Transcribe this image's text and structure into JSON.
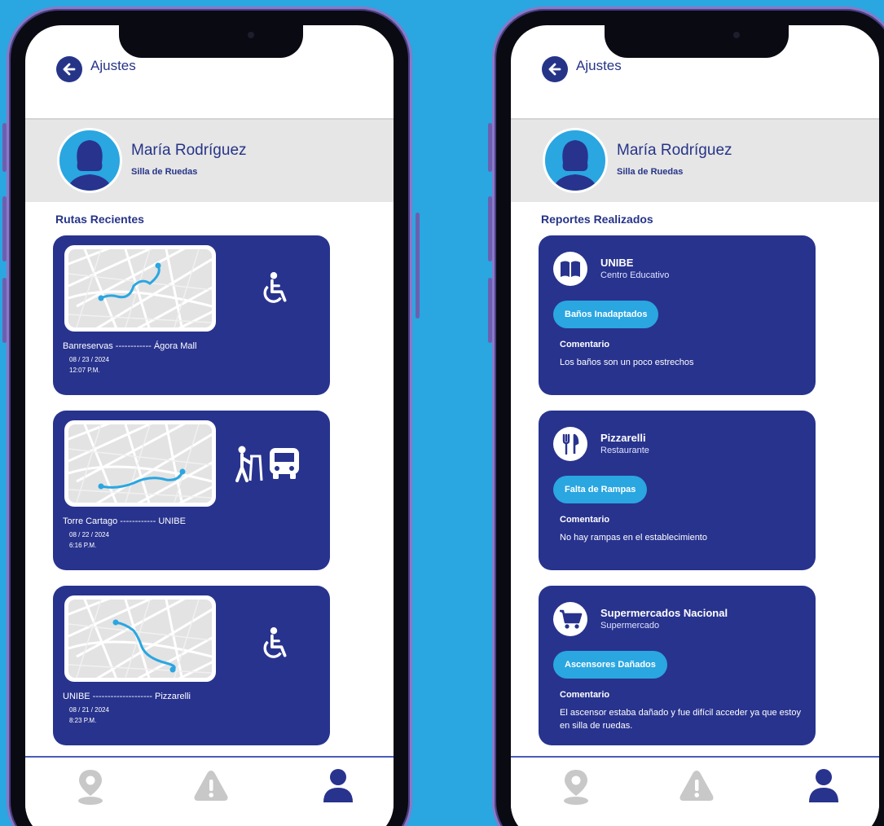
{
  "colors": {
    "background": "#2aa6e1",
    "primary": "#28338e",
    "accent": "#2aa6e1",
    "nav_inactive": "#c8c8c8"
  },
  "left_screen": {
    "header": {
      "title": "Ajustes",
      "back_icon": "arrow-left-icon"
    },
    "profile": {
      "name": "María Rodríguez",
      "subtitle": "Silla de Ruedas",
      "avatar_icon": "user-avatar-icon"
    },
    "section_title": "Rutas Recientes",
    "routes": [
      {
        "route": "Banreservas ------------ Ágora Mall",
        "date": "08 / 23 / 2024",
        "time": "12:07 P.M.",
        "mode_icon": "wheelchair-icon"
      },
      {
        "route": "Torre Cartago ------------ UNIBE",
        "date": "08 / 22 / 2024",
        "time": "6:16 P.M.",
        "mode_icons": [
          "walker-icon",
          "bus-icon"
        ]
      },
      {
        "route": "UNIBE -------------------- Pizzarelli",
        "date": "08 / 21 / 2024",
        "time": "8:23 P.M.",
        "mode_icon": "wheelchair-icon"
      }
    ]
  },
  "right_screen": {
    "header": {
      "title": "Ajustes",
      "back_icon": "arrow-left-icon"
    },
    "profile": {
      "name": "María Rodríguez",
      "subtitle": "Silla de Ruedas",
      "avatar_icon": "user-avatar-icon"
    },
    "section_title": "Reportes Realizados",
    "reports": [
      {
        "place": "UNIBE",
        "type": "Centro Educativo",
        "icon": "book-icon",
        "tag": "Baños Inadaptados",
        "comment_label": "Comentario",
        "comment": "Los baños son un poco estrechos"
      },
      {
        "place": "Pizzarelli",
        "type": "Restaurante",
        "icon": "fork-knife-icon",
        "tag": "Falta de Rampas",
        "comment_label": "Comentario",
        "comment": "No hay rampas en el establecimiento"
      },
      {
        "place": "Supermercados Nacional",
        "type": "Supermercado",
        "icon": "shopping-cart-icon",
        "tag": "Ascensores Dañados",
        "comment_label": "Comentario",
        "comment": "El ascensor estaba dañado y fue difícil acceder ya que estoy en silla de ruedas."
      }
    ]
  },
  "bottom_nav": {
    "items": [
      {
        "icon": "map-pin-icon",
        "active": false
      },
      {
        "icon": "warning-icon",
        "active": false
      },
      {
        "icon": "user-icon",
        "active": true
      }
    ]
  }
}
